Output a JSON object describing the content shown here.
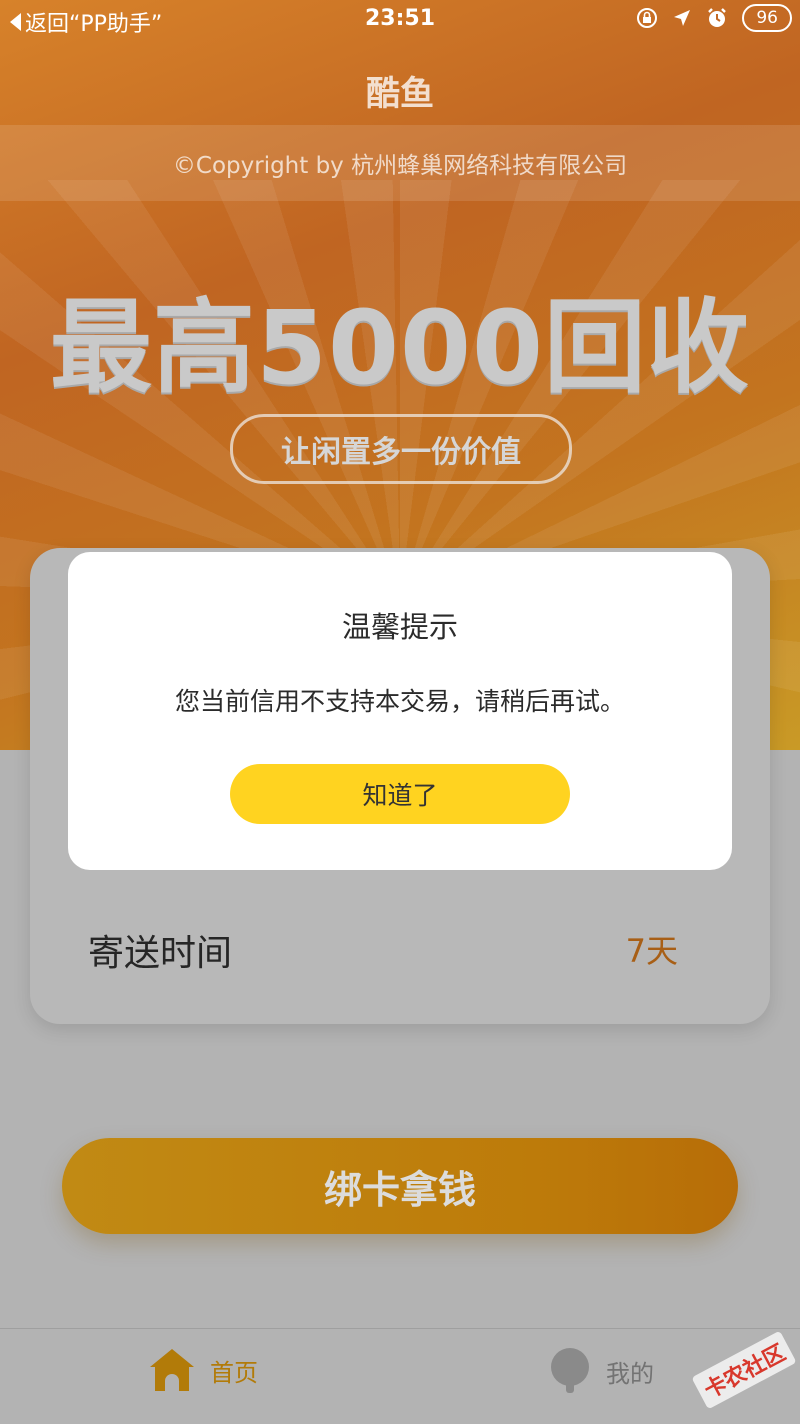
{
  "statusbar": {
    "back_label": "返回“PP助手”",
    "time": "23:51",
    "badge": "96"
  },
  "header": {
    "title": "酷鱼",
    "copyright": "©Copyright by 杭州蜂巢网络科技有限公司"
  },
  "banner": {
    "headline": "最高5000回收",
    "slogan": "让闲置多一份价值"
  },
  "card": {
    "row_label": "寄送时间",
    "row_value": "7天"
  },
  "cta": {
    "label": "绑卡拿钱"
  },
  "tabbar": {
    "home_label": "首页",
    "mine_label": "我的"
  },
  "modal": {
    "title": "温馨提示",
    "message": "您当前信用不支持本交易，请稍后再试。",
    "button": "知道了"
  },
  "watermark": "卡农社区",
  "colors": {
    "accent": "#ffd320",
    "hero_orange": "#c06522",
    "value_orange": "#a85f16",
    "tab_active": "#b27b09"
  },
  "icons": [
    "lock-rotation-icon",
    "location-arrow-icon",
    "alarm-icon",
    "home-icon",
    "user-avatar-icon"
  ]
}
